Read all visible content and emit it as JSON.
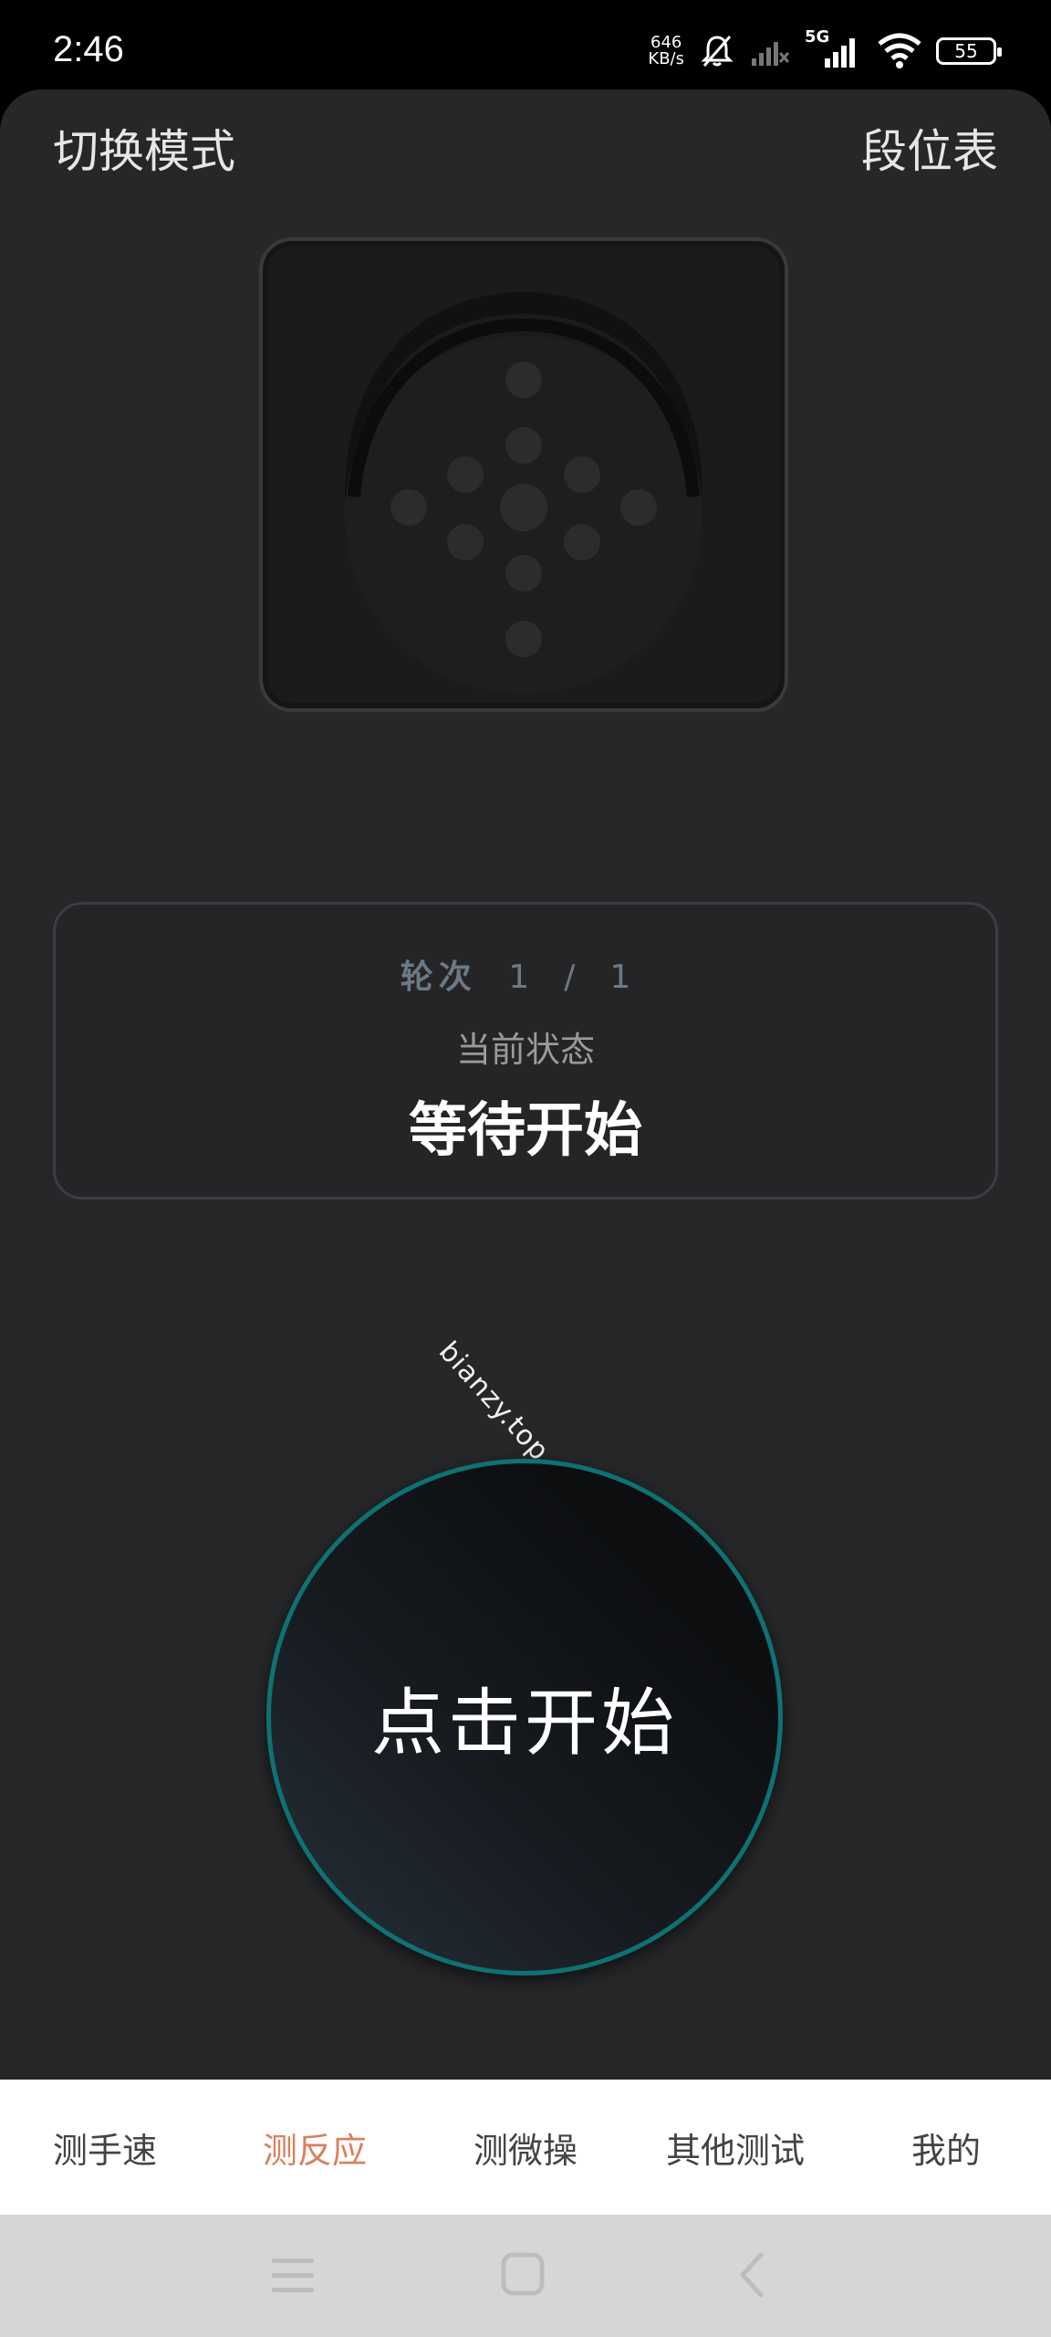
{
  "status_bar": {
    "time": "2:46",
    "speed_value": "646",
    "speed_unit": "KB/s",
    "network": "5G",
    "battery": "55",
    "icons": [
      "mute-bell-icon",
      "signal-off-icon",
      "signal-5g-icon",
      "wifi-icon",
      "battery-icon"
    ]
  },
  "header": {
    "switch_mode": "切换模式",
    "rank_table": "段位表"
  },
  "logo": {
    "icon": "dotted-face-icon"
  },
  "status_card": {
    "round_label": "轮次",
    "round_current": "1",
    "round_sep": "/",
    "round_total": "1",
    "state_label": "当前状态",
    "state_value": "等待开始"
  },
  "watermark": "bianzy.top",
  "start_button": {
    "label": "点击开始",
    "ring_color": "#0e7273"
  },
  "tabs": [
    {
      "label": "测手速",
      "active": false
    },
    {
      "label": "测反应",
      "active": true
    },
    {
      "label": "测微操",
      "active": false
    },
    {
      "label": "其他测试",
      "active": false
    },
    {
      "label": "我的",
      "active": false
    }
  ],
  "colors": {
    "accent": "#d9805e",
    "background": "#262729"
  },
  "system_nav": {
    "icons": [
      "menu-icon",
      "home-icon",
      "back-icon"
    ]
  }
}
